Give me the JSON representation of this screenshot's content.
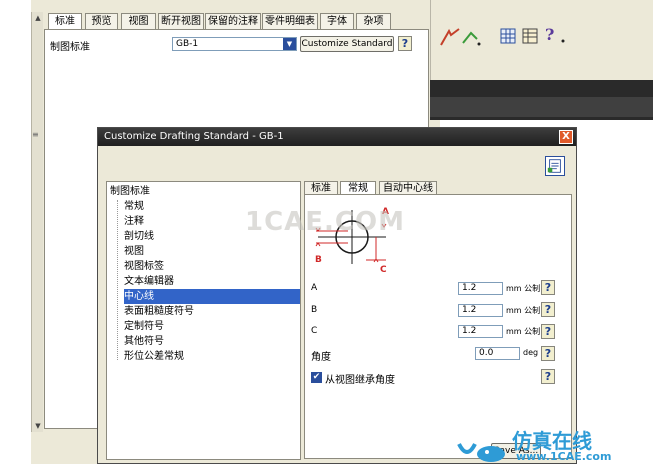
{
  "background_dialog": {
    "tabs": [
      "标准",
      "预览",
      "视图",
      "断开视图",
      "保留的注释",
      "零件明细表",
      "字体",
      "杂项"
    ],
    "active_tab": "标准",
    "standard_label": "制图标准",
    "standard_value": "GB-1",
    "customize_button": "Customize Standard",
    "help": "?"
  },
  "toolbar": {
    "icons": [
      "arrow-tool-icon",
      "grid-icon",
      "table-icon",
      "help-icon"
    ]
  },
  "dialog": {
    "title": "Customize Drafting Standard - GB-1",
    "close": "X",
    "tree": {
      "root": "制图标准",
      "items": [
        "常规",
        "注释",
        "剖切线",
        "视图",
        "视图标签",
        "文本编辑器",
        "中心线",
        "表面粗糙度符号",
        "定制符号",
        "其他符号",
        "形位公差常规"
      ],
      "selected": "中心线"
    },
    "tabs": [
      "标准",
      "常规",
      "自动中心线"
    ],
    "active_tab": "常规",
    "diagram_labels": {
      "a": "A",
      "b": "B",
      "c": "C"
    },
    "fields": [
      {
        "label": "A",
        "value": "1.2",
        "unit": "mm 公制"
      },
      {
        "label": "B",
        "value": "1.2",
        "unit": "mm 公制"
      },
      {
        "label": "C",
        "value": "1.2",
        "unit": "mm 公制"
      },
      {
        "label": "角度",
        "value": "0.0",
        "unit": "deg"
      }
    ],
    "inherit_checkbox": {
      "label": "从视图继承角度",
      "checked": true
    },
    "save_button": "Save As...",
    "help": "?"
  },
  "watermarks": {
    "center": "1CAE.COM",
    "brand": "仿真在线",
    "url": "www.1CAE.com"
  }
}
